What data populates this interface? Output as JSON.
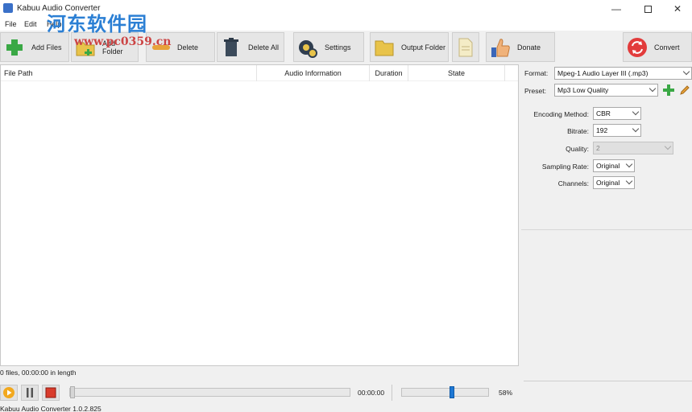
{
  "window": {
    "title": "Kabuu Audio Converter",
    "watermark_text": "河东软件园",
    "watermark_url": "www.pc0359.cn"
  },
  "menu": [
    "File",
    "Edit",
    "Help"
  ],
  "toolbar": {
    "add_files": "Add Files",
    "add_folder": "Add Folder",
    "delete": "Delete",
    "delete_all": "Delete All",
    "settings": "Settings",
    "output_folder": "Output Folder",
    "donate": "Donate",
    "convert": "Convert"
  },
  "file_list": {
    "columns": [
      "File Path",
      "Audio Information",
      "Duration",
      "State"
    ],
    "rows": []
  },
  "settings": {
    "format_label": "Format:",
    "format_value": "Mpeg-1 Audio Layer III (.mp3)",
    "preset_label": "Preset:",
    "preset_value": "Mp3 Low Quality",
    "encoding_label": "Encoding Method:",
    "encoding_value": "CBR",
    "bitrate_label": "Bitrate:",
    "bitrate_value": "192",
    "quality_label": "Quality:",
    "quality_value": "2",
    "sampling_label": "Sampling Rate:",
    "sampling_value": "Original",
    "channels_label": "Channels:",
    "channels_value": "Original"
  },
  "status": {
    "files_summary": "0 files, 00:00:00 in length",
    "app_version": "Kabuu Audio Converter 1.0.2.825"
  },
  "player": {
    "position": "00:00:00",
    "seek_progress": 0,
    "volume_percent": 58,
    "volume_label": "58%"
  },
  "colors": {
    "accent": "#1e78d4",
    "convert_icon": "#e23b3b",
    "add_green": "#3aa845"
  },
  "icons": [
    "app-icon",
    "minimize-icon",
    "maximize-icon",
    "close-icon",
    "add-files-icon",
    "add-folder-icon",
    "delete-icon",
    "delete-all-icon",
    "settings-icon",
    "output-folder-icon",
    "open-folder-icon",
    "donate-icon",
    "convert-icon",
    "add-preset-icon",
    "edit-preset-icon",
    "play-icon",
    "pause-icon",
    "stop-icon"
  ]
}
